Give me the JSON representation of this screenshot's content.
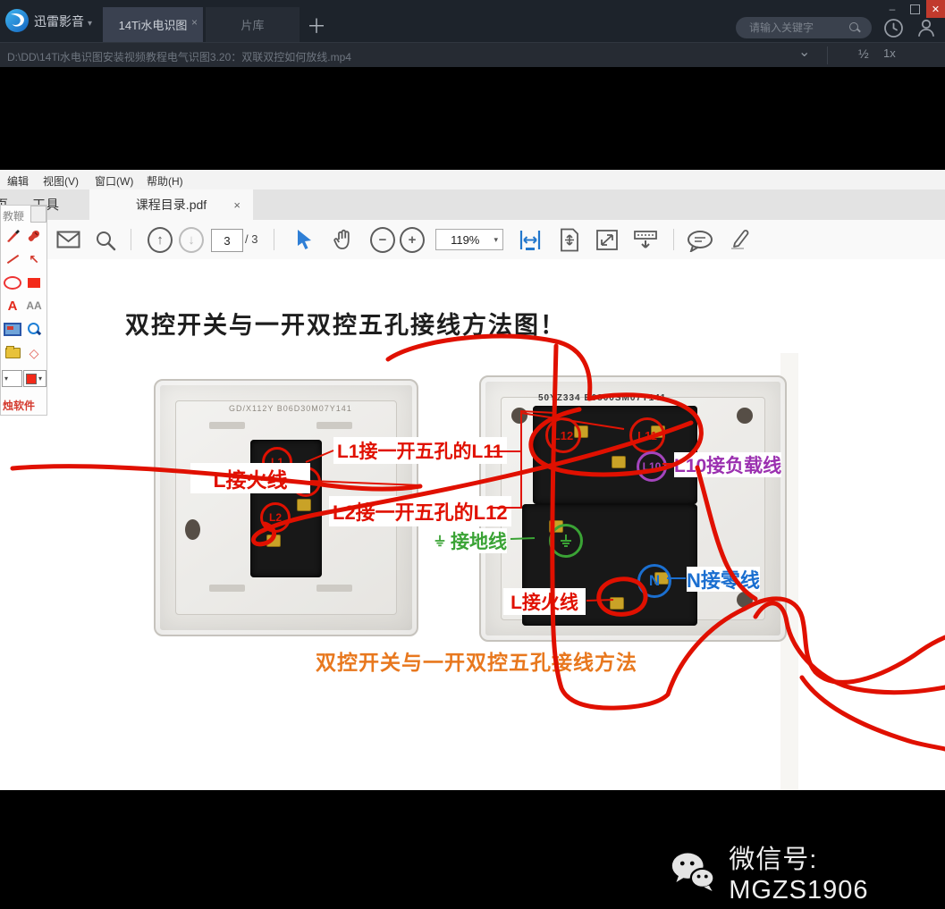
{
  "window": {
    "app_name": "迅雷影音",
    "caret": "▾",
    "tabs": [
      {
        "label": "14Ti水电识图"
      },
      {
        "label": "片库"
      }
    ],
    "new_tab": "＋",
    "tab_close": "×",
    "search_placeholder": "请输入关键字",
    "min": "–",
    "close": "✕"
  },
  "pathbar": {
    "file_path": "D:\\DD\\14Ti水电识图安装视频教程电气识图3.20：双联双控如何放线.mp4",
    "collapse_caret": "⌄",
    "speed_half": "½",
    "speed_normal": "1x"
  },
  "pdf": {
    "menu": [
      "编辑",
      "视图(V)",
      "窗口(W)",
      "帮助(H)"
    ],
    "ribbon_partial": "页",
    "ribbon_tools": "工具",
    "doc_tab": "课程目录.pdf",
    "doc_tab_close": "×",
    "page_current": "3",
    "page_total": "/ 3",
    "zoom_level": "119%",
    "zoom_caret": "▾"
  },
  "panel": {
    "title": "教鞭",
    "footer": "烛软件",
    "letter_a": "A",
    "letter_aa": "AA",
    "arrow_tool": "↖",
    "diamond_tool": "◇",
    "caret": "▾"
  },
  "doc": {
    "title": "双控开关与一开双控五孔接线方法图！",
    "caption": "双控开关与一开双控五孔接线方法",
    "switch_serial": "GD/X112Y B06D30M07Y141",
    "socket_serial": "50YZ334 B0800SM07Y141",
    "terminals": {
      "l1": "L1",
      "l": "L",
      "l2": "L2",
      "l12": "L12",
      "l11": "L11",
      "l10": "L10",
      "n": "N"
    },
    "labels": {
      "live_left": "L接火线",
      "l1_to": "L1接一开五孔的L11",
      "l2_to": "L2接一开五孔的L12",
      "l10_load": "L10接负载线",
      "earth": "接地线",
      "neutral": "N接零线",
      "live_right": "L接火线"
    },
    "colors": {
      "annotation_red": "#e01000",
      "purple": "#9b30b0",
      "green": "#3aa335",
      "blue": "#1b6fd0",
      "orange": "#e8781e"
    }
  },
  "watermark": {
    "text": "微信号: MGZS1906"
  }
}
